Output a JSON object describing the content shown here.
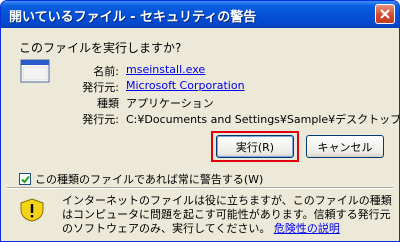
{
  "window": {
    "title": "開いているファイル - セキュリティの警告",
    "close_label": "close"
  },
  "prompt": {
    "question": "このファイルを実行しますか?"
  },
  "file_info": {
    "name_label": "名前:",
    "name_value": "mseinstall.exe",
    "publisher_label": "発行元:",
    "publisher_value": "Microsoft Corporation",
    "type_label": "種類",
    "type_value": "アプリケーション",
    "from_label": "発行元:",
    "from_value": "C:¥Documents and Settings¥Sample¥デスクトップ"
  },
  "buttons": {
    "run_label": "実行(R)",
    "cancel_label": "キャンセル"
  },
  "checkbox": {
    "label": "この種類のファイルであれば常に警告する(W)",
    "checked": true
  },
  "warning": {
    "text": "インターネットのファイルは役に立ちますが、このファイルの種類はコンピュータに問題を起こす可能性があります。信頼する発行元のソフトウェアのみ、実行してください。",
    "link_label": "危険性の説明"
  },
  "colors": {
    "title_bar": "#0552d8",
    "dialog_bg": "#ece9d8",
    "link": "#0000ee",
    "highlight": "#e00010"
  }
}
